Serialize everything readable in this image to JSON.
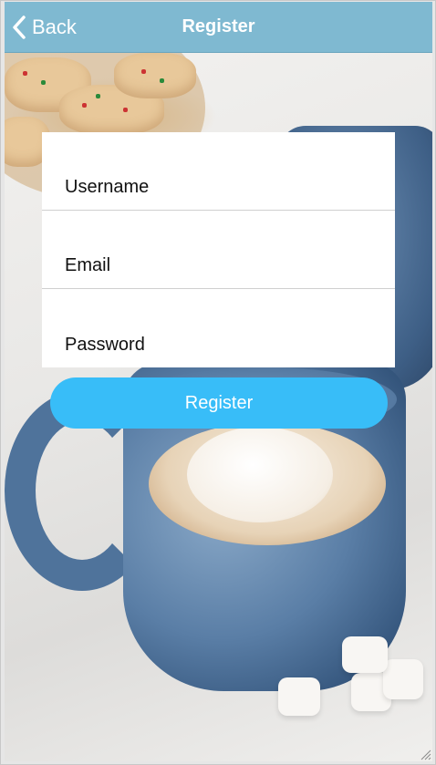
{
  "navbar": {
    "back_label": "Back",
    "title": "Register",
    "color": "#7fb9d1"
  },
  "form": {
    "username_placeholder": "Username",
    "email_placeholder": "Email",
    "password_placeholder": "Password"
  },
  "submit": {
    "label": "Register",
    "color": "#38bdf8"
  },
  "icons": {
    "back": "chevron-left-icon",
    "grip": "resize-grip-icon"
  }
}
